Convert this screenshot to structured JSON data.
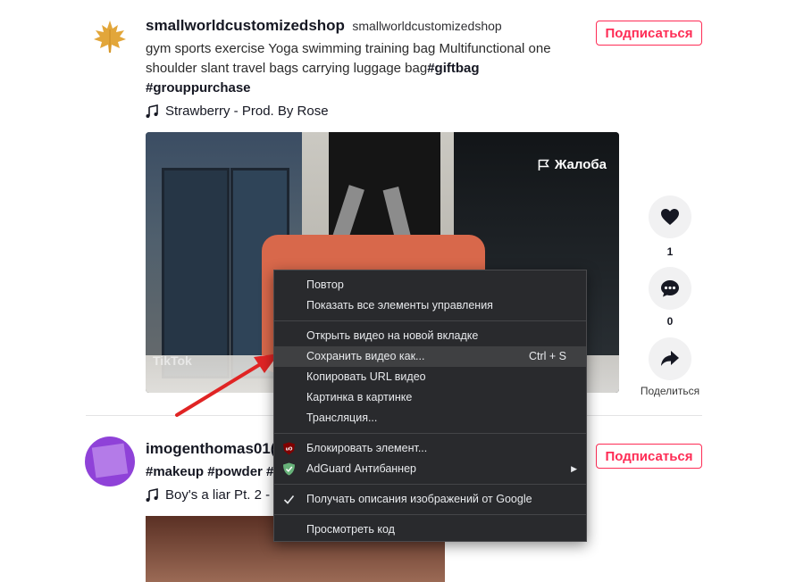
{
  "post1": {
    "username": "smallworldcustomizedshop",
    "nickname": "smallworldcustomizedshop",
    "caption_text": "gym sports exercise Yoga swimming training bag Multifunctional one shoulder slant travel bags carrying luggage bag",
    "hashtag1": "#giftbag",
    "hashtag2": "#grouppurchase",
    "music": "Strawberry - Prod. By Rose",
    "follow_label": "Подписаться",
    "report_label": "Жалоба",
    "watermark": "TikTok",
    "likes": "1",
    "comments": "0",
    "share_label": "Поделиться"
  },
  "post2": {
    "username": "imogenthomas01(",
    "caption": "#makeup #powder #",
    "music": "Boy's a liar Pt. 2 -",
    "follow_label": "Подписаться"
  },
  "menu": {
    "items": [
      {
        "label": "Повтор"
      },
      {
        "label": "Показать все элементы управления"
      },
      {
        "label": "Открыть видео на новой вкладке"
      },
      {
        "label": "Сохранить видео как...",
        "shortcut": "Ctrl + S"
      },
      {
        "label": "Копировать URL видео"
      },
      {
        "label": "Картинка в картинке"
      },
      {
        "label": "Трансляция..."
      },
      {
        "label": "Блокировать элемент..."
      },
      {
        "label": "AdGuard Антибаннер"
      },
      {
        "label": "Получать описания изображений от Google"
      },
      {
        "label": "Просмотреть код"
      }
    ]
  },
  "colors": {
    "accent": "#fe2c55",
    "menu_bg": "#292a2d",
    "arrow": "#e02424"
  },
  "icons": [
    "maple-leaf-logo",
    "music-note-icon",
    "flag-icon",
    "heart-icon",
    "comment-icon",
    "share-icon",
    "ublock-icon",
    "adguard-shield-icon",
    "check-icon",
    "submenu-arrow-icon"
  ]
}
